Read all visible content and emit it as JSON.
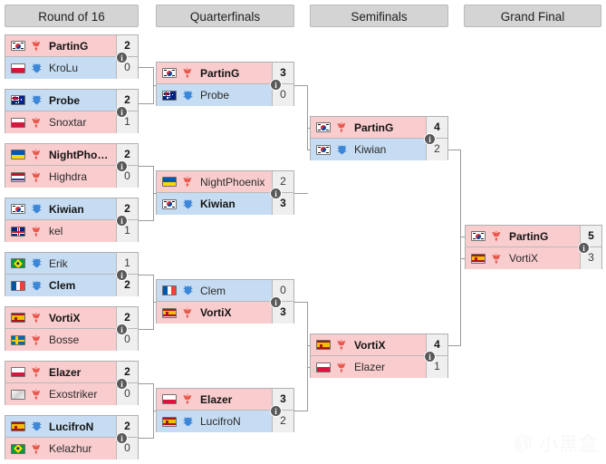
{
  "rounds": [
    {
      "id": "ro16",
      "label": "Round of 16"
    },
    {
      "id": "qf",
      "label": "Quarterfinals"
    },
    {
      "id": "sf",
      "label": "Semifinals"
    },
    {
      "id": "gf",
      "label": "Grand Final"
    }
  ],
  "info_glyph": "i",
  "watermark": {
    "text": "小黑盒"
  },
  "matches": {
    "ro16": [
      {
        "id": "ro16-m1",
        "top": {
          "name": "PartinG",
          "score": "2",
          "race": "terran",
          "country": "kr",
          "winner": true
        },
        "bot": {
          "name": "KroLu",
          "score": "0",
          "race": "protoss",
          "country": "pl",
          "winner": false
        }
      },
      {
        "id": "ro16-m2",
        "top": {
          "name": "Probe",
          "score": "2",
          "race": "protoss",
          "country": "au",
          "winner": true
        },
        "bot": {
          "name": "Snoxtar",
          "score": "1",
          "race": "terran",
          "country": "pl",
          "winner": false
        }
      },
      {
        "id": "ro16-m3",
        "top": {
          "name": "NightPhoenix",
          "score": "2",
          "race": "terran",
          "country": "ua",
          "winner": true
        },
        "bot": {
          "name": "Highdra",
          "score": "0",
          "race": "terran",
          "country": "nl",
          "winner": false
        }
      },
      {
        "id": "ro16-m4",
        "top": {
          "name": "Kiwian",
          "score": "2",
          "race": "protoss",
          "country": "kr",
          "winner": true
        },
        "bot": {
          "name": "kel",
          "score": "1",
          "race": "terran",
          "country": "gb",
          "winner": false
        }
      },
      {
        "id": "ro16-m5",
        "top": {
          "name": "Erik",
          "score": "1",
          "race": "protoss",
          "country": "br",
          "winner": false
        },
        "bot": {
          "name": "Clem",
          "score": "2",
          "race": "protoss",
          "country": "fr",
          "winner": true
        }
      },
      {
        "id": "ro16-m6",
        "top": {
          "name": "VortiX",
          "score": "2",
          "race": "terran",
          "country": "es",
          "winner": true
        },
        "bot": {
          "name": "Bosse",
          "score": "0",
          "race": "terran",
          "country": "se",
          "winner": false
        }
      },
      {
        "id": "ro16-m7",
        "top": {
          "name": "Elazer",
          "score": "2",
          "race": "terran",
          "country": "pl",
          "winner": true
        },
        "bot": {
          "name": "Exostriker",
          "score": "0",
          "race": "terran",
          "country": "xx",
          "winner": false
        }
      },
      {
        "id": "ro16-m8",
        "top": {
          "name": "LucifroN",
          "score": "2",
          "race": "protoss",
          "country": "es",
          "winner": true
        },
        "bot": {
          "name": "Kelazhur",
          "score": "0",
          "race": "terran",
          "country": "br",
          "winner": false
        }
      }
    ],
    "qf": [
      {
        "id": "qf-m1",
        "top": {
          "name": "PartinG",
          "score": "3",
          "race": "terran",
          "country": "kr",
          "winner": true
        },
        "bot": {
          "name": "Probe",
          "score": "0",
          "race": "protoss",
          "country": "au",
          "winner": false
        }
      },
      {
        "id": "qf-m2",
        "top": {
          "name": "NightPhoenix",
          "score": "2",
          "race": "terran",
          "country": "ua",
          "winner": false
        },
        "bot": {
          "name": "Kiwian",
          "score": "3",
          "race": "protoss",
          "country": "kr",
          "winner": true
        }
      },
      {
        "id": "qf-m3",
        "top": {
          "name": "Clem",
          "score": "0",
          "race": "protoss",
          "country": "fr",
          "winner": false
        },
        "bot": {
          "name": "VortiX",
          "score": "3",
          "race": "terran",
          "country": "es",
          "winner": true
        }
      },
      {
        "id": "qf-m4",
        "top": {
          "name": "Elazer",
          "score": "3",
          "race": "terran",
          "country": "pl",
          "winner": true
        },
        "bot": {
          "name": "LucifroN",
          "score": "2",
          "race": "protoss",
          "country": "es",
          "winner": false
        }
      }
    ],
    "sf": [
      {
        "id": "sf-m1",
        "top": {
          "name": "PartinG",
          "score": "4",
          "race": "terran",
          "country": "kr",
          "winner": true
        },
        "bot": {
          "name": "Kiwian",
          "score": "2",
          "race": "protoss",
          "country": "kr",
          "winner": false
        }
      },
      {
        "id": "sf-m2",
        "top": {
          "name": "VortiX",
          "score": "4",
          "race": "terran",
          "country": "es",
          "winner": true
        },
        "bot": {
          "name": "Elazer",
          "score": "1",
          "race": "terran",
          "country": "pl",
          "winner": false
        }
      }
    ],
    "gf": [
      {
        "id": "gf-m1",
        "top": {
          "name": "PartinG",
          "score": "5",
          "race": "terran",
          "country": "kr",
          "winner": true
        },
        "bot": {
          "name": "VortiX",
          "score": "3",
          "race": "terran",
          "country": "es",
          "winner": false
        }
      }
    ]
  },
  "colors": {
    "terran_row": "#f9ccce",
    "protoss_row": "#c6dcf2",
    "header_bg": "#d4d4d4",
    "score_bg": "#efefef",
    "line": "#9a9a9a"
  }
}
